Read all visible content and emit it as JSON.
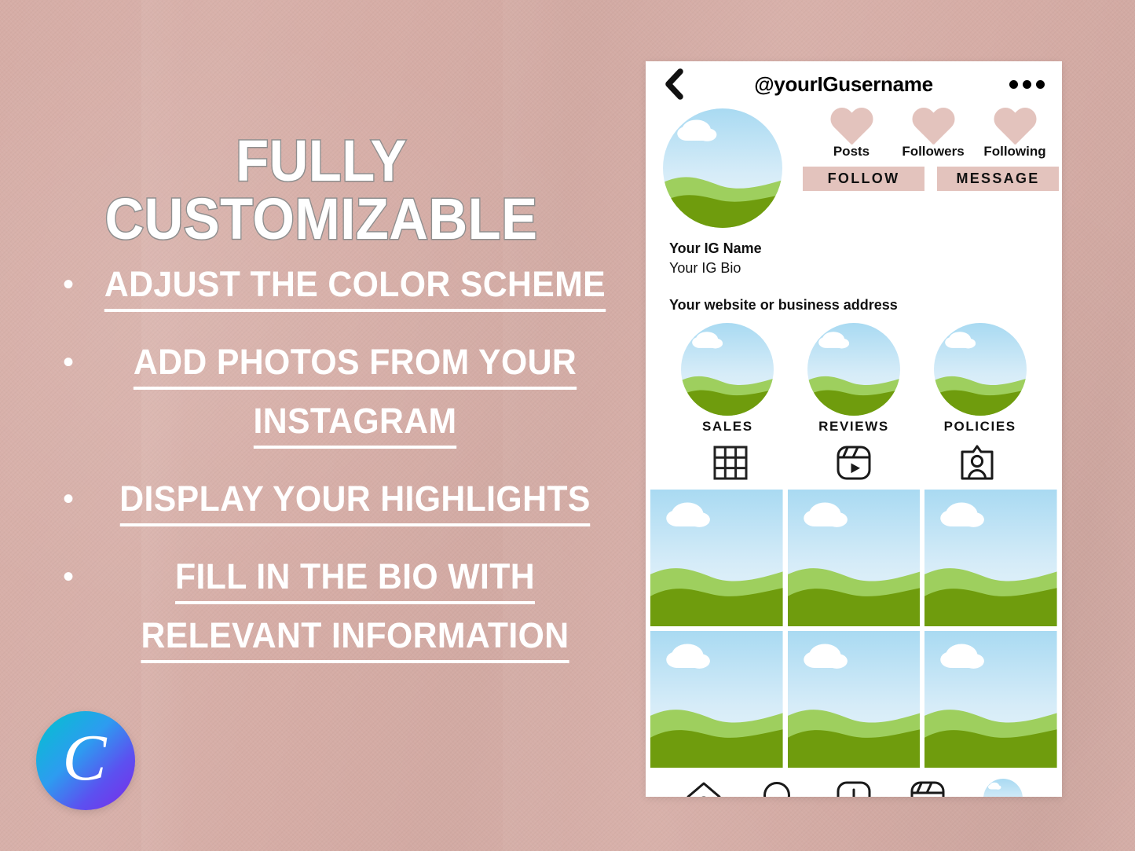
{
  "palette": {
    "background": "#d6ada6",
    "card": "#ffffff",
    "accent_pink": "#e3c3bd",
    "ink": "#111111",
    "headline_fill": "#ffffff",
    "headline_stroke": "#8f8f8f",
    "sky_top": "#addcf3",
    "sky_bottom": "#e9f6fb",
    "hill_light": "#9ecf5e",
    "hill_dark": "#6f9c0d",
    "canva_gradient_start": "#00c4cc",
    "canva_gradient_end": "#7d2ae8"
  },
  "left": {
    "headline": "FULLY CUSTOMIZABLE",
    "bullets": [
      {
        "lines": [
          "ADJUST THE COLOR SCHEME"
        ]
      },
      {
        "lines": [
          "ADD PHOTOS FROM YOUR",
          "INSTAGRAM"
        ]
      },
      {
        "lines": [
          "DISPLAY YOUR HIGHLIGHTS "
        ]
      },
      {
        "lines": [
          "FILL IN THE BIO WITH",
          "RELEVANT INFORMATION"
        ]
      }
    ],
    "bullet_marker": "•",
    "logo": {
      "name": "canva-logo",
      "letter": "C"
    }
  },
  "phone": {
    "header": {
      "back_icon": "chevron-left-icon",
      "username": "@yourIGusername",
      "menu_icon": "more-options-icon"
    },
    "avatar_alt": "landscape-placeholder",
    "stats": [
      {
        "label": "Posts",
        "icon": "heart-icon"
      },
      {
        "label": "Followers",
        "icon": "heart-icon"
      },
      {
        "label": "Following",
        "icon": "heart-icon"
      }
    ],
    "actions": [
      {
        "label": "FOLLOW"
      },
      {
        "label": "MESSAGE"
      }
    ],
    "profile": {
      "name": "Your IG Name",
      "bio": "Your IG Bio",
      "website": "Your website or business address"
    },
    "highlights": [
      {
        "label": "SALES"
      },
      {
        "label": "REVIEWS"
      },
      {
        "label": "POLICIES"
      }
    ],
    "tabs": [
      {
        "icon": "grid-icon"
      },
      {
        "icon": "reels-icon"
      },
      {
        "icon": "tagged-icon"
      }
    ],
    "posts": [
      {
        "alt": "landscape-placeholder"
      },
      {
        "alt": "landscape-placeholder"
      },
      {
        "alt": "landscape-placeholder"
      },
      {
        "alt": "landscape-placeholder"
      },
      {
        "alt": "landscape-placeholder"
      },
      {
        "alt": "landscape-placeholder"
      }
    ],
    "bottom_nav": [
      {
        "icon": "home-icon"
      },
      {
        "icon": "search-icon"
      },
      {
        "icon": "add-post-icon"
      },
      {
        "icon": "reels-icon"
      },
      {
        "icon": "profile-avatar-icon"
      }
    ]
  }
}
